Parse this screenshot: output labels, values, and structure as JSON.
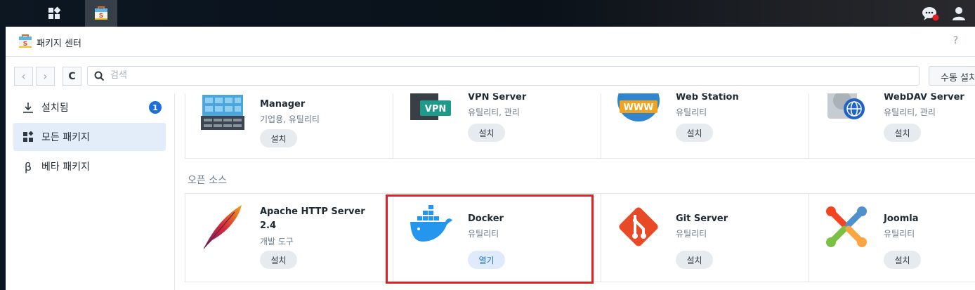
{
  "window": {
    "title": "패키지 센터",
    "help": "?"
  },
  "toolbar": {
    "back": "‹",
    "forward": "›",
    "refresh": "C",
    "search_placeholder": "검색",
    "manual_install": "수동 설치"
  },
  "sidebar": {
    "items": [
      {
        "label": "설치됨",
        "badge": "1",
        "icon": "download-icon"
      },
      {
        "label": "모든 패키지",
        "icon": "grid-icon",
        "active": true
      },
      {
        "label": "베타 패키지",
        "icon": "beta-icon"
      }
    ]
  },
  "top_row": [
    {
      "name": "Manager",
      "category": "기업용, 유틸리티",
      "action": "설치"
    },
    {
      "name": "VPN Server",
      "category": "유틸리티, 관리",
      "action": "설치"
    },
    {
      "name": "Web Station",
      "category": "유틸리티",
      "action": "설치"
    },
    {
      "name": "WebDAV Server",
      "category": "유틸리티, 관리",
      "action": "설치"
    }
  ],
  "section": {
    "title": "오픈 소스"
  },
  "open_source": [
    {
      "name": "Apache HTTP Server 2.4",
      "category": "개발 도구",
      "action": "설치"
    },
    {
      "name": "Docker",
      "category": "유틸리티",
      "action": "열기"
    },
    {
      "name": "Git Server",
      "category": "유틸리티",
      "action": "설치"
    },
    {
      "name": "Joomla",
      "category": "유틸리티",
      "action": "설치"
    }
  ],
  "colors": {
    "accent": "#1e6fd9",
    "highlight": "#e31e24",
    "active_bg": "#e2edf9"
  }
}
